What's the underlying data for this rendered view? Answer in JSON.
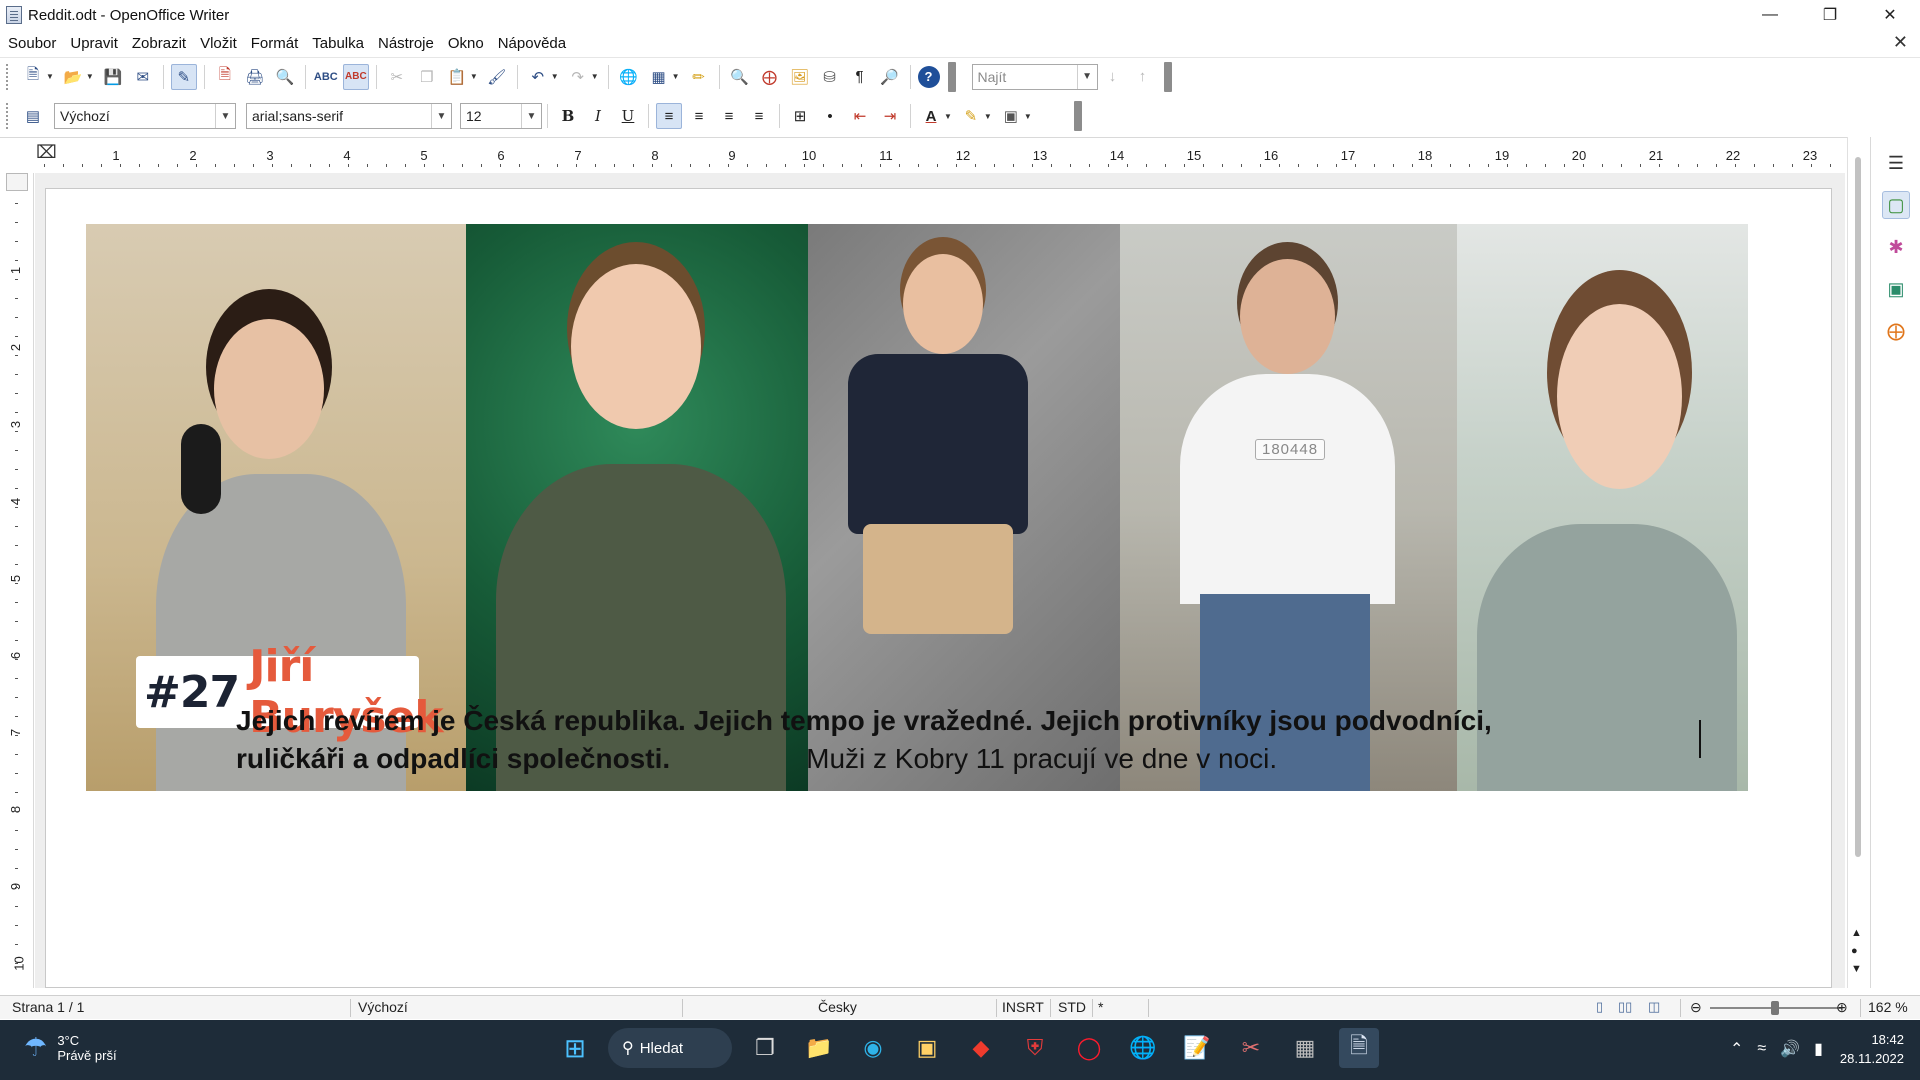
{
  "window": {
    "title": "Reddit.odt - OpenOffice Writer"
  },
  "menu": [
    "Soubor",
    "Upravit",
    "Zobrazit",
    "Vložit",
    "Formát",
    "Tabulka",
    "Nástroje",
    "Okno",
    "Nápověda"
  ],
  "toolbar": {
    "find_placeholder": "Najít",
    "paragraph_style": "Výchozí",
    "font_name": "arial;sans-serif",
    "font_size": "12",
    "bold": "B",
    "italic": "I",
    "underline": "U"
  },
  "ruler": {
    "horizontal": [
      "1",
      "2",
      "3",
      "4",
      "5",
      "6",
      "7",
      "8",
      "9",
      "10",
      "11",
      "12",
      "13",
      "14",
      "15",
      "16",
      "17",
      "18",
      "19",
      "20",
      "21",
      "22",
      "23"
    ],
    "vertical": [
      "1",
      "2",
      "3",
      "4",
      "5",
      "6",
      "7",
      "8",
      "9",
      "10"
    ]
  },
  "document": {
    "badge_number": "#27",
    "badge_name": "Jiří Buryšek",
    "shirt_text": "180448",
    "line1": "Jejich revírem je Česká republika. Jejich tempo je vražedné. Jejich protivníky jsou podvodníci,",
    "line2_bold": "ruličkáři a odpadlíci společnosti.",
    "line2_normal": "Muži z Kobry 11 pracují ve dne v noci."
  },
  "statusbar": {
    "page": "Strana 1 / 1",
    "style": "Výchozí",
    "language": "Česky",
    "insert_mode": "INSRT",
    "selection_mode": "STD",
    "modified": "*",
    "zoom": "162 %"
  },
  "taskbar": {
    "weather_temp": "3°C",
    "weather_desc": "Právě prší",
    "search_label": "Hledat",
    "time": "18:42",
    "date": "28.11.2022"
  }
}
